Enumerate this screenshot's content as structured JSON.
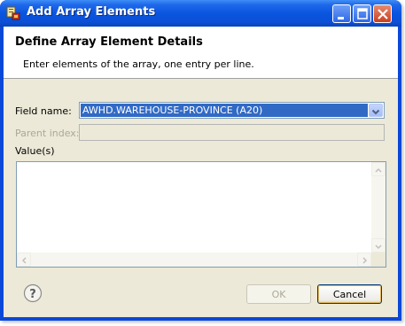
{
  "window": {
    "title": "Add Array Elements"
  },
  "header": {
    "title": "Define Array Element Details",
    "description": "Enter elements of the array, one entry per line."
  },
  "form": {
    "field_name_label": "Field name:",
    "field_name_value": "AWHD.WAREHOUSE-PROVINCE (A20)",
    "parent_index_label": "Parent index:",
    "parent_index_value": "",
    "values_label": "Value(s)",
    "values_text": ""
  },
  "buttons": {
    "ok": "OK",
    "cancel": "Cancel"
  },
  "icons": {
    "title": "app-icon",
    "help": "help-icon",
    "combo_arrow": "chevron-down-icon"
  },
  "colors": {
    "selection": "#316ac5",
    "titlebar": "#0a55e0",
    "dialog_bg": "#ece9d8"
  }
}
